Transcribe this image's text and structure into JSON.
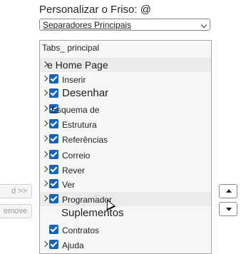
{
  "ribbon": {
    "title": "Personalizar o Friso: @",
    "dropdown_value": "Separadores Principais"
  },
  "tree": {
    "header": "Tabs_ principal",
    "items": [
      {
        "label": "e Home Page",
        "checked": false,
        "expander": true
      },
      {
        "label": "Inserir",
        "checked": true,
        "expander": true
      },
      {
        "label": "Desenhar",
        "checked": true,
        "expander": true
      },
      {
        "label": "Esquema de",
        "checked": true,
        "expander": true
      },
      {
        "label": "Estrutura",
        "checked": true,
        "expander": true
      },
      {
        "label": "Referências",
        "checked": true,
        "expander": true
      },
      {
        "label": "Correio",
        "checked": true,
        "expander": true
      },
      {
        "label": "Rever",
        "checked": true,
        "expander": true
      },
      {
        "label": "Ver",
        "checked": true,
        "expander": true
      },
      {
        "label": "Programador",
        "checked": true,
        "expander": true
      },
      {
        "label": "Suplementos",
        "checked": false,
        "expander": false
      },
      {
        "label": "Contratos",
        "checked": true,
        "expander": false
      },
      {
        "label": "Ajuda",
        "checked": true,
        "expander": true
      }
    ]
  },
  "buttons": {
    "add_label": "d >>",
    "remove_label": "emove"
  },
  "icons": {
    "move_up": "triangle-up-icon",
    "move_down": "triangle-down-icon",
    "expander": "chevron-right-icon",
    "checkbox": "checkbox-checked-icon",
    "cursor": "mouse-pointer-icon"
  },
  "colors": {
    "checkbox": "#1565c0",
    "highlight_row": "#ebebeb"
  }
}
